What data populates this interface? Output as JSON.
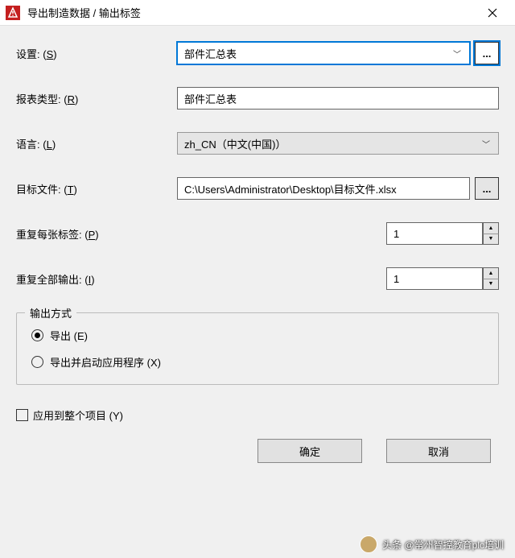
{
  "window": {
    "title": "导出制造数据 / 输出标签"
  },
  "labels": {
    "settings": "设置:",
    "settings_key": "S",
    "report_type": "报表类型:",
    "report_type_key": "R",
    "language": "语言:",
    "language_key": "L",
    "target_file": "目标文件:",
    "target_file_key": "T",
    "repeat_each": "重复每张标签:",
    "repeat_each_key": "P",
    "repeat_all": "重复全部输出:",
    "repeat_all_key": "I",
    "output_mode": "输出方式",
    "export": "导出",
    "export_key": "E",
    "export_launch": "导出并启动应用程序",
    "export_launch_key": "X",
    "apply_project": "应用到整个项目",
    "apply_project_key": "Y"
  },
  "values": {
    "settings_selected": "部件汇总表",
    "report_type_value": "部件汇总表",
    "language_selected": "zh_CN（中文(中国)）",
    "target_file_value": "C:\\Users\\Administrator\\Desktop\\目标文件.xlsx",
    "repeat_each_value": "1",
    "repeat_all_value": "1",
    "output_mode_selected": "export",
    "apply_project_checked": false
  },
  "buttons": {
    "browse": "...",
    "ok": "确定",
    "cancel": "取消"
  },
  "watermark": {
    "prefix": "头条",
    "account": "@常州智控教育plc培训"
  }
}
